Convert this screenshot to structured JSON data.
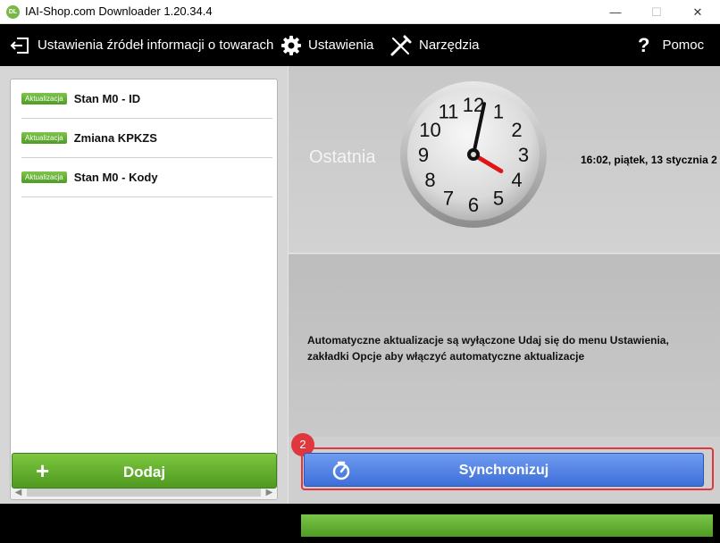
{
  "window": {
    "title": "IAI-Shop.com Downloader 1.20.34.4",
    "app_icon_text": "DL",
    "minimize": "—",
    "maximize": "☐",
    "close": "✕"
  },
  "toolbar": {
    "sources_label": "Ustawienia źródeł informacji o towarach",
    "settings_label": "Ustawienia",
    "tools_label": "Narzędzia",
    "help_label": "Pomoc"
  },
  "tasks": {
    "badge": "Aktualizacja",
    "items": [
      {
        "label": "Stan M0 - ID"
      },
      {
        "label": "Zmiana KPKZS"
      },
      {
        "label": "Stan M0 - Kody"
      }
    ]
  },
  "add_button": {
    "icon": "+",
    "label": "Dodaj"
  },
  "last_sync": {
    "label": "Ostatnia",
    "datetime": "16:02, piątek, 13 stycznia 2",
    "clock": {
      "hour": 16,
      "minute": 2,
      "numerals": [
        "12",
        "1",
        "2",
        "3",
        "4",
        "5",
        "6",
        "7",
        "8",
        "9",
        "10",
        "11"
      ]
    }
  },
  "auto_update_message": "Automatyczne aktualizacje są wyłączone Udaj się do menu Ustawienia, zakładki Opcje aby włączyć automatyczne aktualizacje",
  "sync_button": {
    "label": "Synchronizuj"
  },
  "step_badge": "2",
  "progress": {
    "value_percent": 100
  },
  "colors": {
    "accent_green": "#5aa82c",
    "sync_blue": "#4a7ce0",
    "highlight_red": "#e0363d"
  }
}
